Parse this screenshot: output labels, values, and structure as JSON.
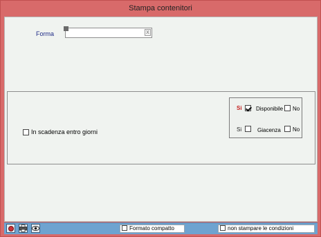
{
  "window": {
    "title": "Stampa contenitori"
  },
  "form": {
    "forma_label": "Forma",
    "forma_value": "",
    "forma_clear": "X"
  },
  "options": {
    "scadenza_label": "In scadenza entro giorni",
    "scadenza_checked": false
  },
  "filter_panel": {
    "rows": [
      {
        "si_label": "Si",
        "si_checked": true,
        "label": "Disponibile",
        "no_label": "No",
        "no_checked": false,
        "highlight": true
      },
      {
        "si_label": "Si",
        "si_checked": false,
        "label": "Giacenza",
        "no_label": "No",
        "no_checked": false,
        "highlight": false
      }
    ]
  },
  "toolbar": {
    "buttons": [
      {
        "name": "exit-icon"
      },
      {
        "name": "print-icon"
      },
      {
        "name": "preview-eye-icon"
      }
    ],
    "formato_compatto_label": "Formato compatto",
    "formato_compatto_checked": false,
    "non_stampare_label": "non stampare le condizioni",
    "non_stampare_checked": false
  },
  "colors": {
    "title_bar": "#d86a6a",
    "client_bg": "#f0f3f0",
    "bottom_bar": "#6ea3d0",
    "label_blue": "#1e2a86",
    "si_red": "#c41e1e"
  }
}
